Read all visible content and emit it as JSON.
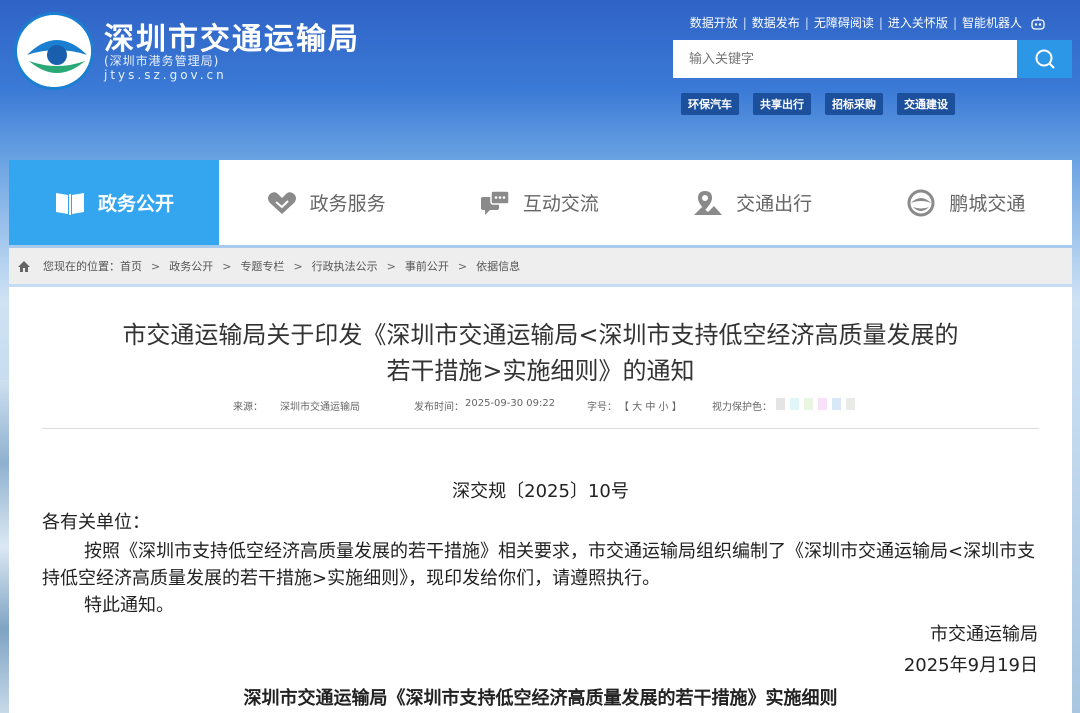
{
  "header": {
    "title": "深圳市交通运输局",
    "subtitle": "(深圳市港务管理局)",
    "domain": "jtys.sz.gov.cn",
    "top_links": [
      "数据开放",
      "数据发布",
      "无障碍阅读",
      "进入关怀版",
      "智能机器人"
    ],
    "search_placeholder": "输入关键字",
    "hot_tags": [
      "环保汽车",
      "共享出行",
      "招标采购",
      "交通建设"
    ]
  },
  "nav": {
    "items": [
      {
        "label": "政务公开",
        "icon": "book-icon",
        "active": true
      },
      {
        "label": "政务服务",
        "icon": "handshake-icon",
        "active": false
      },
      {
        "label": "互动交流",
        "icon": "chat-icon",
        "active": false
      },
      {
        "label": "交通出行",
        "icon": "map-pin-icon",
        "active": false
      },
      {
        "label": "鹏城交通",
        "icon": "swirl-logo-icon",
        "active": false
      }
    ]
  },
  "breadcrumb": {
    "prefix": "您现在的位置：",
    "items": [
      "首页",
      "政务公开",
      "专题专栏",
      "行政执法公示",
      "事前公开",
      "依据信息"
    ],
    "separator": ">"
  },
  "article": {
    "title_line1": "市交通运输局关于印发《深圳市交通运输局<深圳市支持低空经济高质量发展的",
    "title_line2": "若干措施>实施细则》的通知",
    "meta": {
      "source_label": "来源：",
      "source_value": "深圳市交通运输局",
      "date_label": "发布时间：",
      "date_value": "2025-09-30 09:22",
      "font_label": "字号：",
      "font_value": "【 大 中 小 】",
      "eye_label": "视力保护色：",
      "eye_colors": [
        "#e4e4e4",
        "#e0f6f8",
        "#e8f6e2",
        "#f8e0f8",
        "#d8e8f8",
        "#e8ece8"
      ]
    },
    "doc_number": "深交规〔2025〕10号",
    "salutation": "各有关单位：",
    "paragraph": "按照《深圳市支持低空经济高质量发展的若干措施》相关要求，市交通运输局组织编制了《深圳市交通运输局<深圳市支持低空经济高质量发展的若干措施>实施细则》，现印发给你们，请遵照执行。",
    "notice_end": "特此通知。",
    "signer": "市交通运输局",
    "sign_date": "2025年9月19日",
    "attachment_title": "深圳市交通运输局《深圳市支持低空经济高质量发展的若干措施》实施细则"
  }
}
